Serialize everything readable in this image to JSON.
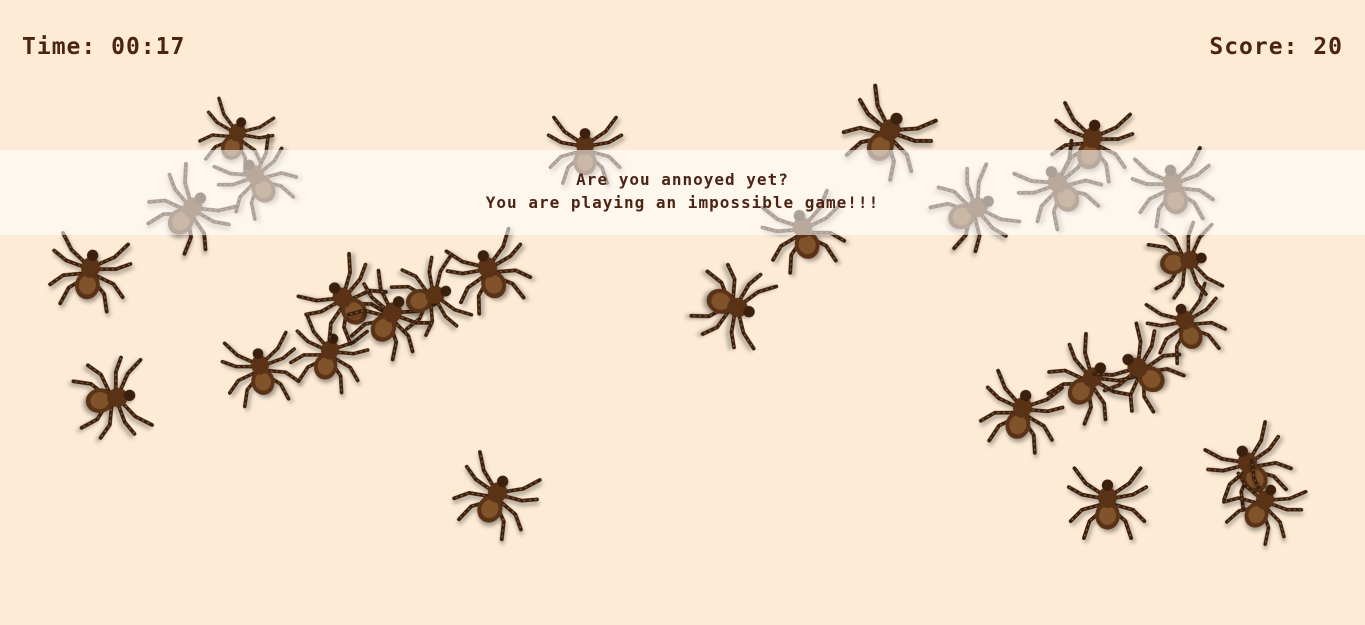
{
  "hud": {
    "time_label": "Time:",
    "time_value": "00:17",
    "score_label": "Score:",
    "score_value": "20"
  },
  "message": {
    "line1": "Are you annoyed yet?",
    "line2": "You are playing an impossible game!!!"
  },
  "colors": {
    "background": "#fdebd6",
    "text": "#4b2413",
    "spider_body": "#5a3317",
    "spider_legs": "#3b200e",
    "spider_hair": "#b07a45"
  },
  "sprites": {
    "spider_icon": "tarantula-icon"
  }
}
